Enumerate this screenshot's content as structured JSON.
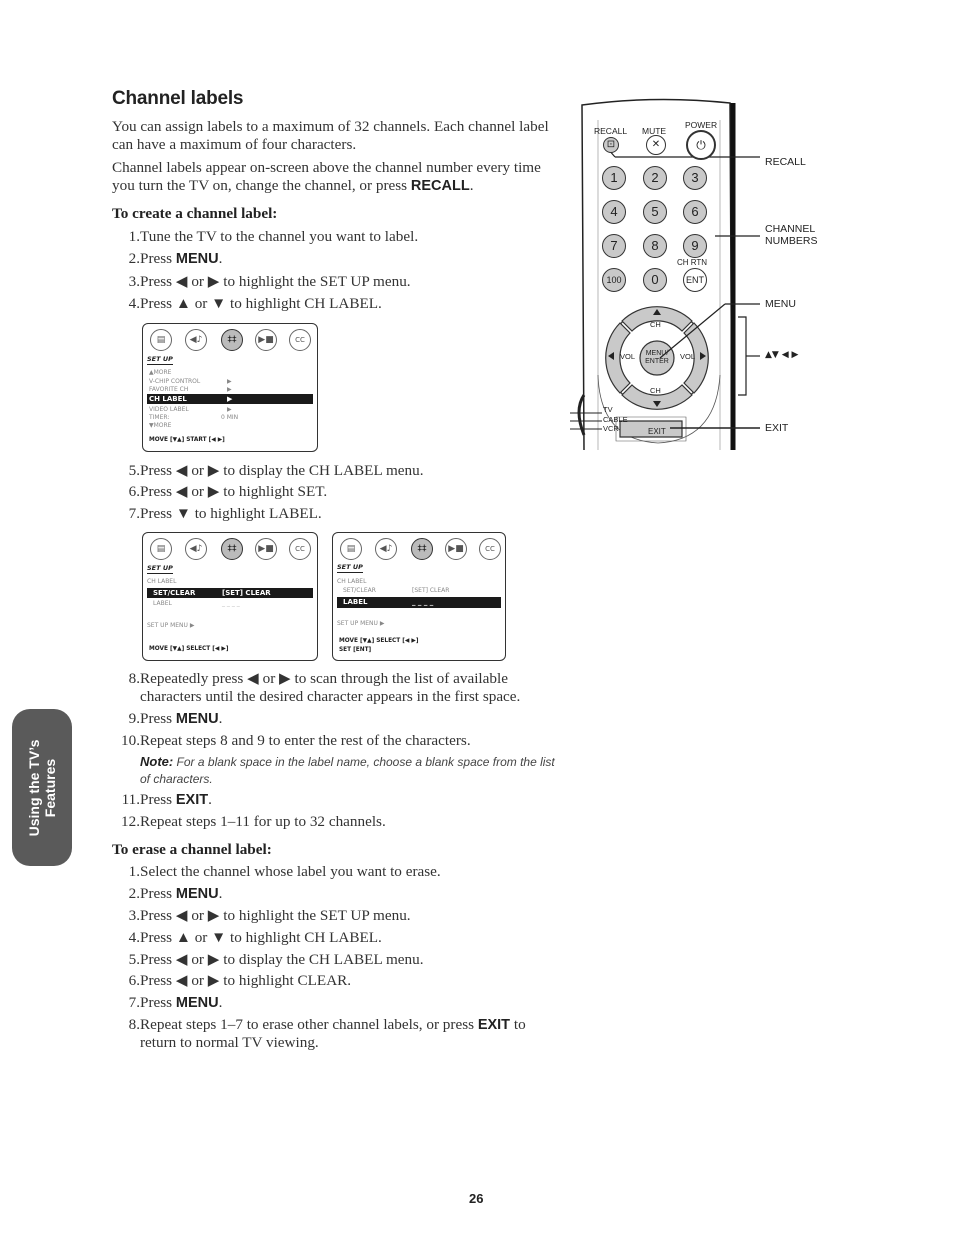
{
  "title": "Channel labels",
  "intro": [
    "You can assign labels to a maximum of 32 channels. Each channel label can have a maximum of four characters.",
    "Channel labels appear on-screen above the channel number every time you turn the TV on, change the channel, or press"
  ],
  "intro_kw": "RECALL",
  "create": {
    "heading": "To create a channel label:",
    "steps": [
      {
        "num": "1.",
        "pre": "Tune the TV to the channel you want to label."
      },
      {
        "num": "2.",
        "pre": "Press ",
        "kw": "MENU",
        "post": "."
      },
      {
        "num": "3.",
        "pre": "Press ◀ or ▶ to highlight the SET UP menu."
      },
      {
        "num": "4.",
        "pre": "Press ▲ or ▼ to highlight CH LABEL."
      },
      {
        "num": "5.",
        "pre": "Press ◀ or ▶ to display the CH LABEL menu."
      },
      {
        "num": "6.",
        "pre": "Press ◀ or ▶ to highlight SET."
      },
      {
        "num": "7.",
        "pre": "Press ▼ to highlight LABEL."
      },
      {
        "num": "8.",
        "pre": "Repeatedly press ◀ or ▶ to scan through the list of available characters until the desired character appears in the first space."
      },
      {
        "num": "9.",
        "pre": "Press ",
        "kw": "MENU",
        "post": "."
      },
      {
        "num": "10.",
        "pre": "Repeat steps 8 and 9 to enter the rest of the characters."
      },
      {
        "num": "11.",
        "pre": "Press ",
        "kw": "EXIT",
        "post": "."
      },
      {
        "num": "12.",
        "pre": "Repeat steps 1–11 for up to 32 channels."
      }
    ],
    "note_label": "Note:",
    "note_text": " For a blank space in the label name, choose a blank space from the list of characters."
  },
  "erase": {
    "heading": "To erase a channel label:",
    "steps": [
      {
        "num": "1.",
        "pre": "Select the channel whose label you want to erase."
      },
      {
        "num": "2.",
        "pre": "Press ",
        "kw": "MENU",
        "post": "."
      },
      {
        "num": "3.",
        "pre": "Press ◀ or ▶ to highlight the SET UP menu."
      },
      {
        "num": "4.",
        "pre": "Press ▲ or ▼ to highlight CH LABEL."
      },
      {
        "num": "5.",
        "pre": "Press ◀ or ▶ to display the CH LABEL menu."
      },
      {
        "num": "6.",
        "pre": "Press ◀ or ▶ to highlight CLEAR."
      },
      {
        "num": "7.",
        "pre": "Press ",
        "kw": "MENU",
        "post": "."
      },
      {
        "num": "8.",
        "pre": "Repeat steps 1–7 to erase other channel labels, or press ",
        "kw": "EXIT",
        "post": " to return to normal TV viewing."
      }
    ]
  },
  "osd1": {
    "icons": [
      "picture-icon",
      "audio-icon",
      "setup-icon",
      "video-icon",
      "cc-icon"
    ],
    "header": "SET UP",
    "rows": [
      {
        "label": "▲MORE",
        "value": ""
      },
      {
        "label": "V-CHIP CONTROL",
        "value": "▶"
      },
      {
        "label": "FAVORITE CH",
        "value": "▶"
      },
      {
        "label": "CH LABEL",
        "value": "▶",
        "highlight": true
      },
      {
        "label": "VIDEO LABEL",
        "value": "▶"
      },
      {
        "label": "TIMER:",
        "value": "0 MIN"
      },
      {
        "label": "▼MORE",
        "value": ""
      }
    ],
    "footer": "MOVE [▼▲]      START [◀ ▶]"
  },
  "osd2": {
    "header": "SET UP",
    "title_row": "CH LABEL",
    "row1": {
      "label": "SET/CLEAR",
      "value": "[SET]  CLEAR"
    },
    "row2": {
      "label": "LABEL",
      "value": "_ _ _ _"
    },
    "menu_link": "SET UP MENU ▶",
    "footer": "MOVE [▼▲]     SELECT [◀ ▶]"
  },
  "osd3": {
    "header": "SET UP",
    "title_row": "CH LABEL",
    "row1": {
      "label": "SET/CLEAR",
      "value": "[SET]  CLEAR"
    },
    "row2": {
      "label": "LABEL",
      "value": "_ _ _ _"
    },
    "menu_link": "SET UP MENU ▶",
    "footer": "MOVE [▼▲]     SELECT [◀ ▶]",
    "footer2": "SET [ENT]"
  },
  "remote": {
    "top_labels": {
      "recall": "RECALL",
      "mute": "MUTE",
      "power": "POWER"
    },
    "digits": [
      "1",
      "2",
      "3",
      "4",
      "5",
      "6",
      "7",
      "8",
      "9",
      "100",
      "0",
      "ENT"
    ],
    "ch_rtn": "CH RTN",
    "dpad": {
      "up": "CH",
      "down": "CH",
      "left": "VOL",
      "right": "VOL",
      "center": "MENU/ ENTER"
    },
    "switch": [
      "TV",
      "CABLE",
      "VCR"
    ],
    "exit": "EXIT",
    "callouts": {
      "recall": "RECALL",
      "channel_numbers": "CHANNEL NUMBERS",
      "menu": "MENU",
      "arrows": "▲▼ ◀ ▶",
      "exit": "EXIT"
    }
  },
  "side_tab": {
    "line1": "Using the TV’s",
    "line2": "Features"
  },
  "page_number": "26"
}
